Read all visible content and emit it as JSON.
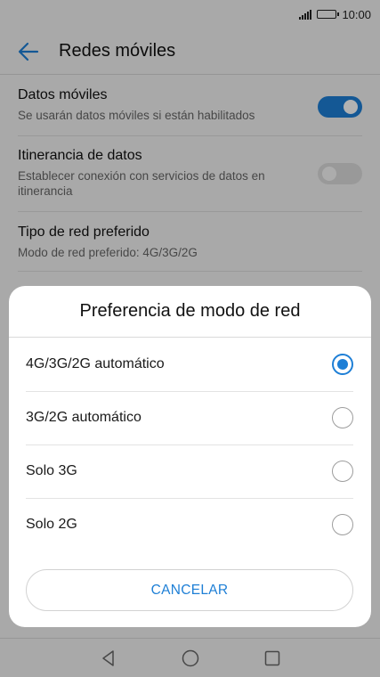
{
  "status_bar": {
    "time": "10:00"
  },
  "app_bar": {
    "title": "Redes móviles"
  },
  "settings": [
    {
      "title": "Datos móviles",
      "subtitle": "Se usarán datos móviles si están habilitados",
      "toggle": "on"
    },
    {
      "title": "Itinerancia de datos",
      "subtitle": "Establecer conexión con servicios de datos en itinerancia",
      "toggle": "off"
    },
    {
      "title": "Tipo de red preferido",
      "subtitle": "Modo de red preferido: 4G/3G/2G"
    }
  ],
  "dialog": {
    "title": "Preferencia de modo de red",
    "options": [
      {
        "label": "4G/3G/2G automático",
        "selected": true
      },
      {
        "label": "3G/2G automático",
        "selected": false
      },
      {
        "label": "Solo 3G",
        "selected": false
      },
      {
        "label": "Solo 2G",
        "selected": false
      }
    ],
    "cancel_label": "CANCELAR"
  },
  "colors": {
    "accent": "#1e7fd6",
    "scrim": "#000000"
  },
  "icons": {
    "back": "back-arrow-icon",
    "nav": [
      "nav-back-icon",
      "nav-home-icon",
      "nav-recents-icon"
    ]
  }
}
